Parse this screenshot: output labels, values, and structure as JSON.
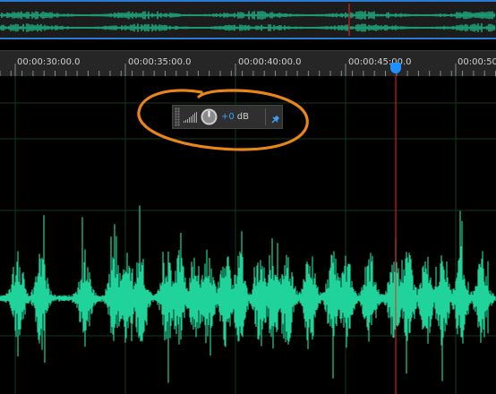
{
  "timeline": {
    "tick_labels": [
      "00:00:30:00.0",
      "00:00:35:00.0",
      "00:00:40:00.0",
      "00:00:45:00.0",
      "00:00:50"
    ]
  },
  "hud": {
    "gain_value": "+0",
    "gain_unit": "dB",
    "icons": [
      "grip-icon",
      "level-meter-icon",
      "volume-knob-icon",
      "pin-icon"
    ]
  },
  "colors": {
    "waveform": "#1fd39a",
    "playhead": "#ff2020",
    "playhead_marker": "#1e90ff",
    "annotation": "#e8861a",
    "gain_value": "#3aa0ff",
    "overview_border": "#2a7bd0"
  }
}
